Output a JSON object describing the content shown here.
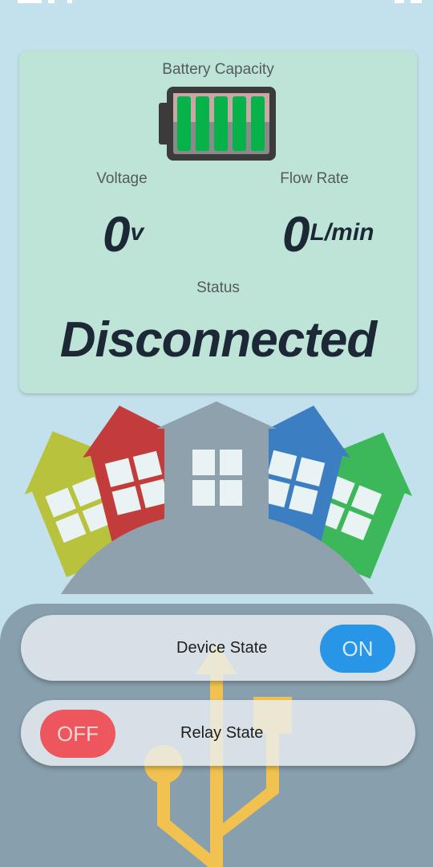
{
  "card": {
    "battery_label": "Battery Capacity",
    "battery_bars": 5,
    "voltage_label": "Voltage",
    "voltage_value": "0",
    "voltage_unit": "v",
    "flow_label": "Flow Rate",
    "flow_value": "0",
    "flow_unit": "L/min",
    "status_label": "Status",
    "status_value": "Disconnected"
  },
  "controls": {
    "device_state_label": "Device State",
    "device_toggle": "ON",
    "relay_state_label": "Relay State",
    "relay_toggle": "OFF"
  },
  "icons": {
    "battery": "battery-full-icon",
    "houses": "houses-on-hill-illustration",
    "usb": "usb-icon"
  },
  "colors": {
    "background": "#c2e1ec",
    "card": "#bde4d7",
    "text_dark": "#1d2836",
    "on": "#1a8fe8",
    "off": "#f04b52",
    "battery_green": "#08b24b",
    "usb": "#f1c24f"
  }
}
